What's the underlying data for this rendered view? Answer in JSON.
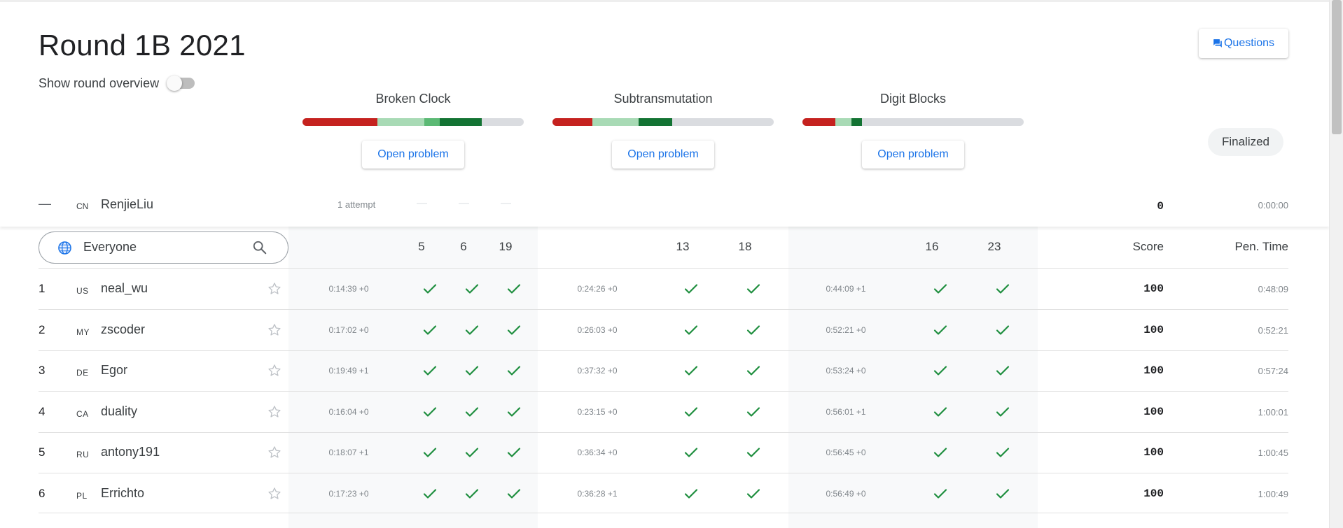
{
  "header": {
    "title": "Round 1B 2021",
    "overview_label": "Show round overview",
    "overview_enabled": false,
    "questions_label": "Questions",
    "status_badge": "Finalized"
  },
  "problems": [
    {
      "name": "Broken Clock",
      "open_label": "Open problem",
      "progress": [
        {
          "color": "#c5221f",
          "fraction": 0.34
        },
        {
          "color": "#a8dab5",
          "fraction": 0.21
        },
        {
          "color": "#5bb974",
          "fraction": 0.07
        },
        {
          "color": "#137333",
          "fraction": 0.19
        }
      ]
    },
    {
      "name": "Subtransmutation",
      "open_label": "Open problem",
      "progress": [
        {
          "color": "#c5221f",
          "fraction": 0.18
        },
        {
          "color": "#a8dab5",
          "fraction": 0.21
        },
        {
          "color": "#137333",
          "fraction": 0.15
        }
      ]
    },
    {
      "name": "Digit Blocks",
      "open_label": "Open problem",
      "progress": [
        {
          "color": "#c5221f",
          "fraction": 0.15
        },
        {
          "color": "#a8dab5",
          "fraction": 0.07
        },
        {
          "color": "#137333",
          "fraction": 0.05
        }
      ]
    }
  ],
  "current_user": {
    "rank": "—",
    "country": "CN",
    "username": "RenjieLiu",
    "attempts": "1 attempt",
    "test_set_placeholders": [
      "—",
      "—",
      "—"
    ],
    "score": "0",
    "penalty_time": "0:00:00"
  },
  "filter": {
    "value": "Everyone"
  },
  "columns": {
    "problem1_points": [
      "5",
      "6",
      "19"
    ],
    "problem2_points": [
      "13",
      "18"
    ],
    "problem3_points": [
      "16",
      "23"
    ],
    "score": "Score",
    "penalty_time": "Pen. Time"
  },
  "colors": {
    "accent": "#1a73e8",
    "check": "#1e8e3e",
    "shaded_column": "#f8f9fa"
  },
  "rows": [
    {
      "rank": "1",
      "country": "US",
      "username": "neal_wu",
      "times": [
        "0:14:39 +0",
        "0:24:26 +0",
        "0:44:09 +1"
      ],
      "score": "100",
      "penalty_time": "0:48:09"
    },
    {
      "rank": "2",
      "country": "MY",
      "username": "zscoder",
      "times": [
        "0:17:02 +0",
        "0:26:03 +0",
        "0:52:21 +0"
      ],
      "score": "100",
      "penalty_time": "0:52:21"
    },
    {
      "rank": "3",
      "country": "DE",
      "username": "Egor",
      "times": [
        "0:19:49 +1",
        "0:37:32 +0",
        "0:53:24 +0"
      ],
      "score": "100",
      "penalty_time": "0:57:24"
    },
    {
      "rank": "4",
      "country": "CA",
      "username": "duality",
      "times": [
        "0:16:04 +0",
        "0:23:15 +0",
        "0:56:01 +1"
      ],
      "score": "100",
      "penalty_time": "1:00:01"
    },
    {
      "rank": "5",
      "country": "RU",
      "username": "antony191",
      "times": [
        "0:18:07 +1",
        "0:36:34 +0",
        "0:56:45 +0"
      ],
      "score": "100",
      "penalty_time": "1:00:45"
    },
    {
      "rank": "6",
      "country": "PL",
      "username": "Errichto",
      "times": [
        "0:17:23 +0",
        "0:36:28 +1",
        "0:56:49 +0"
      ],
      "score": "100",
      "penalty_time": "1:00:49"
    }
  ]
}
